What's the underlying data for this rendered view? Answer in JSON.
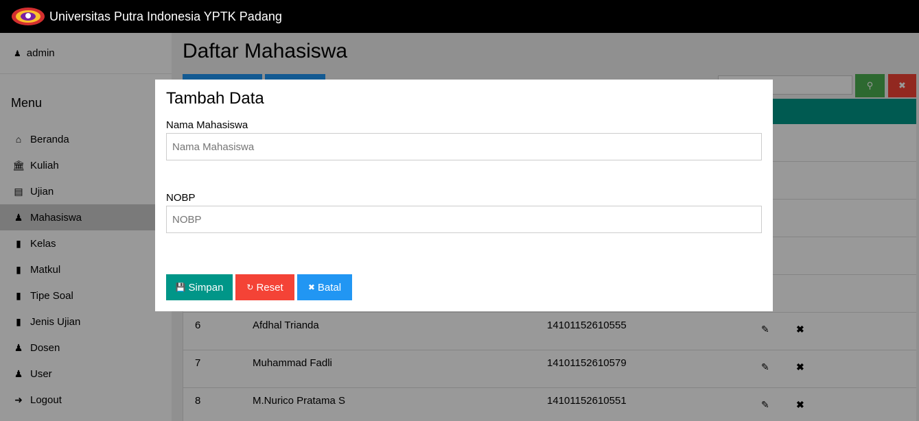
{
  "header": {
    "logo_icon": "university-logo-icon",
    "title": "Universitas Putra Indonesia YPTK Padang"
  },
  "sidebar": {
    "user": {
      "icon": "user-icon",
      "name": "admin"
    },
    "menu_title": "Menu",
    "items": [
      {
        "icon": "home-icon",
        "label": "Beranda",
        "active": false
      },
      {
        "icon": "bank-icon",
        "label": "Kuliah",
        "active": false
      },
      {
        "icon": "list-icon",
        "label": "Ujian",
        "active": false
      },
      {
        "icon": "users-icon",
        "label": "Mahasiswa",
        "active": true
      },
      {
        "icon": "book-icon",
        "label": "Kelas",
        "active": false
      },
      {
        "icon": "book-icon",
        "label": "Matkul",
        "active": false
      },
      {
        "icon": "book-icon",
        "label": "Tipe Soal",
        "active": false
      },
      {
        "icon": "book-icon",
        "label": "Jenis Ujian",
        "active": false
      },
      {
        "icon": "user-secret-icon",
        "label": "Dosen",
        "active": false
      },
      {
        "icon": "user-secret-icon",
        "label": "User",
        "active": false
      },
      {
        "icon": "sign-out-icon",
        "label": "Logout",
        "active": false
      }
    ]
  },
  "main": {
    "title": "Daftar Mahasiswa",
    "search": {
      "placeholder": "",
      "search_icon": "search-icon",
      "clear_icon": "close-icon"
    },
    "table": {
      "rows": [
        {
          "no": "6",
          "name": "Afdhal Trianda",
          "nobp": "14101152610555"
        },
        {
          "no": "7",
          "name": "Muhammad Fadli",
          "nobp": "14101152610579"
        },
        {
          "no": "8",
          "name": "M.Nurico Pratama S",
          "nobp": "14101152610551"
        }
      ]
    }
  },
  "modal": {
    "title": "Tambah Data",
    "fields": [
      {
        "label": "Nama Mahasiswa",
        "placeholder": "Nama Mahasiswa",
        "value": ""
      },
      {
        "label": "NOBP",
        "placeholder": "NOBP",
        "value": ""
      }
    ],
    "buttons": {
      "save": {
        "label": "Simpan",
        "icon": "save-icon"
      },
      "reset": {
        "label": "Reset",
        "icon": "refresh-icon"
      },
      "cancel": {
        "label": "Batal",
        "icon": "close-icon"
      }
    }
  },
  "colors": {
    "topbar": "#000000",
    "teal": "#009688",
    "blue": "#2196F3",
    "red": "#f44336",
    "green": "#4CAF50",
    "active_nav": "#cccccc"
  }
}
